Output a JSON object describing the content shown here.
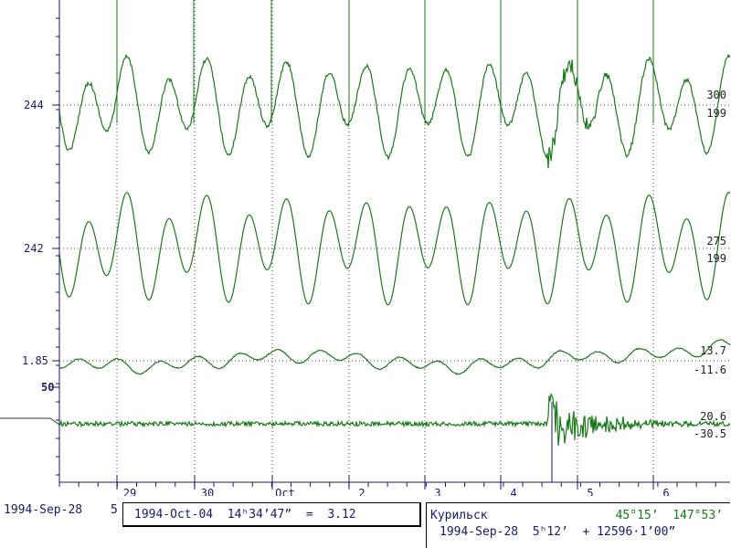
{
  "chart_data": {
    "type": "line",
    "x_axis": {
      "ticks": [
        "29",
        "30",
        "Oct",
        "2",
        "3",
        "4",
        "5",
        "6"
      ],
      "start": "1994-Sep-28",
      "end": "1994-Oct-07"
    },
    "y_tick_labels": [
      "244",
      "242",
      "1.85",
      "50"
    ],
    "series": [
      {
        "ticks": [
          "300",
          "199"
        ],
        "kind": "tide-signal",
        "color": "#1a7a1a"
      },
      {
        "ticks": [
          "275",
          "199"
        ],
        "kind": "tide-model",
        "color": "#1a7a1a"
      },
      {
        "ticks": [
          "13.7",
          "-11.6"
        ],
        "kind": "residual",
        "color": "#1a7a1a"
      },
      {
        "ticks": [
          "20.6",
          "-30.5"
        ],
        "kind": "seismic-noise",
        "color": "#1a7a1a"
      }
    ],
    "events": [
      {
        "date": "1994-Oct-04",
        "description": "tsunami onset near day 4.6"
      }
    ]
  },
  "footer": {
    "start_date": "1994-Sep-28",
    "start_tail": "5",
    "readout": "1994-Oct-04  14ʰ34’47”  =  3.12",
    "station": "Курильск",
    "coords": "45°15’  147°53’",
    "record_start": "1994-Sep-28  5ʰ12’  + 12596·1’00”"
  },
  "colors": {
    "trace": "#1a7a1a",
    "axis": "#1a1a66",
    "grid": "#444444",
    "background": "#ffffff"
  }
}
